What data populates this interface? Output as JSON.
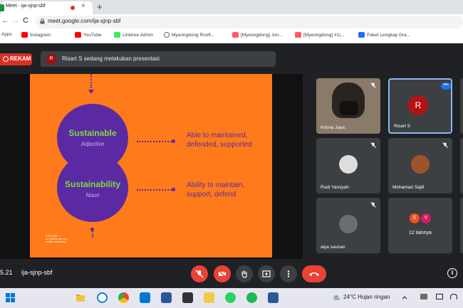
{
  "browser": {
    "tab_title": "Meet - ija-sjnp-sbf",
    "new_tab": "+",
    "tab_close": "×",
    "url": "meet.google.com/ija-sjnp-sbf",
    "nav_back": "←",
    "nav_forward": "→",
    "nav_reload": "C",
    "bookmarks": [
      {
        "label": "Apps",
        "icon": "apps-grid-icon",
        "color": "#4285f4"
      },
      {
        "label": "Instagram",
        "icon": "youtube-icon",
        "color": "#ff0000"
      },
      {
        "label": "YouTube",
        "icon": "youtube-icon",
        "color": "#ff0000"
      },
      {
        "label": "Linktree Admin",
        "icon": "linktree-icon",
        "color": "#43e660"
      },
      {
        "label": "Myeongdong Rooft...",
        "icon": "google-icon",
        "color": "#5f6368"
      },
      {
        "label": "[Myeongdong] Jon...",
        "icon": "airbnb-icon",
        "color": "#ff5a5f"
      },
      {
        "label": "[Myeongdong] #1|...",
        "icon": "airbnb-icon",
        "color": "#ff5a5f"
      },
      {
        "label": "Paket Lengkap Dra...",
        "icon": "link-icon",
        "color": "#1a73e8"
      }
    ]
  },
  "meet": {
    "record_label": "REKAM",
    "presenter_initial": "R",
    "presenter_text": "Risart S sedang melakukan presentasi",
    "slide": {
      "word1": "Sustainable",
      "pos1": "Adjective",
      "def1_line1": "Able to maintained,",
      "def1_line2": "defended, supported",
      "word2": "Sustainability",
      "pos2": "Noun",
      "def2_line1": "Ability to maintain,",
      "def2_line2": "support, defend",
      "footer_line1": "© RS 2021",
      "footer_line2": "An internal use only",
      "footer_line3": "strictly confidential"
    },
    "participants": [
      {
        "name": "Krisna Jaya"
      },
      {
        "name": "Risart S",
        "initial": "R",
        "color": "#b31412"
      },
      {
        "name": "Rudi Yansyah"
      },
      {
        "name": "Mohamad Sajili"
      },
      {
        "name": "aiya sausan"
      },
      {
        "name": "12 lainnya",
        "initials": [
          "S",
          "V"
        ],
        "colors": [
          "#f4511e",
          "#d81b60"
        ]
      }
    ],
    "clock": "5.21",
    "meeting_code": "ija-sjnp-sbf",
    "info_icon": "i"
  },
  "taskbar": {
    "weather": "24°C  Hujan ringan"
  }
}
